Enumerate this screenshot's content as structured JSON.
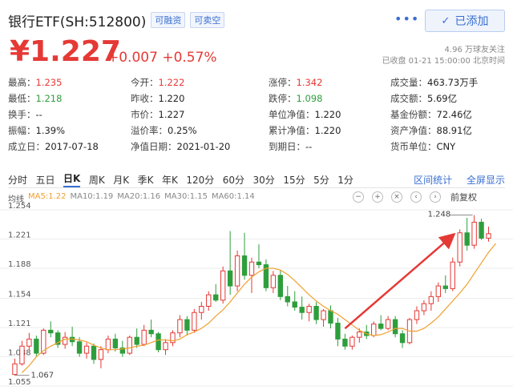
{
  "header": {
    "name": "银行ETF(SH:512800)",
    "tags": [
      "可融资",
      "可卖空"
    ],
    "more_icon": "ellipsis-icon",
    "add_button": "已添加"
  },
  "quote": {
    "price": "¥1.227",
    "change": "+0.007",
    "change_pct": "+0.57%",
    "followers": "4.96 万球友关注",
    "status_time": "已收盘 01-21 15:00:00 北京时间"
  },
  "stats": [
    [
      {
        "label": "最高：",
        "value": "1.235",
        "color": "red"
      },
      {
        "label": "今开：",
        "value": "1.222",
        "color": "red"
      },
      {
        "label": "涨停：",
        "value": "1.342",
        "color": "red"
      },
      {
        "label": "成交量：",
        "value": "463.73万手",
        "color": ""
      }
    ],
    [
      {
        "label": "最低：",
        "value": "1.218",
        "color": "green"
      },
      {
        "label": "昨收：",
        "value": "1.220",
        "color": ""
      },
      {
        "label": "跌停：",
        "value": "1.098",
        "color": "green"
      },
      {
        "label": "成交额：",
        "value": "5.69亿",
        "color": ""
      }
    ],
    [
      {
        "label": "换手：",
        "value": "--",
        "color": ""
      },
      {
        "label": "市价：",
        "value": "1.227",
        "color": ""
      },
      {
        "label": "单位净值：",
        "value": "1.220",
        "color": ""
      },
      {
        "label": "基金份额：",
        "value": "72.46亿",
        "color": ""
      }
    ],
    [
      {
        "label": "振幅：",
        "value": "1.39%",
        "color": ""
      },
      {
        "label": "溢价率：",
        "value": "0.25%",
        "color": ""
      },
      {
        "label": "累计净值：",
        "value": "1.220",
        "color": ""
      },
      {
        "label": "资产净值：",
        "value": "88.91亿",
        "color": ""
      }
    ],
    [
      {
        "label": "成立日：",
        "value": "2017-07-18",
        "color": ""
      },
      {
        "label": "净值日期：",
        "value": "2021-01-20",
        "color": ""
      },
      {
        "label": "到期日：",
        "value": "--",
        "color": ""
      },
      {
        "label": "货币单位：",
        "value": "CNY",
        "color": ""
      }
    ]
  ],
  "tabs": [
    "分时",
    "五日",
    "日K",
    "周K",
    "月K",
    "季K",
    "年K",
    "120分",
    "60分",
    "30分",
    "15分",
    "5分",
    "1分"
  ],
  "active_tab": "日K",
  "tab_links": [
    "区间统计",
    "全屏显示"
  ],
  "ma_legend": [
    {
      "label": "均线",
      "color": "#555555"
    },
    {
      "label": "MA5:1.22",
      "color": "#f0a030"
    },
    {
      "label": "MA10:1.19",
      "color": "#888888"
    },
    {
      "label": "MA20:1.16",
      "color": "#888888"
    },
    {
      "label": "MA30:1.15",
      "color": "#888888"
    },
    {
      "label": "MA60:1.14",
      "color": "#888888"
    }
  ],
  "chart_controls": {
    "icons": [
      "zoom-out-icon",
      "zoom-in-icon",
      "zoom-reset-icon",
      "scroll-left-icon",
      "scroll-right-icon"
    ],
    "adjust_label": "前复权"
  },
  "colors": {
    "up": "#e53935",
    "down": "#2e9e3d",
    "ma5": "#f0a030",
    "accent": "#3a6fd1"
  },
  "chart_data": {
    "type": "candlestick",
    "y_ticks": [
      "1.254",
      "1.221",
      "1.188",
      "1.154",
      "1.121",
      "1.088",
      "1.055"
    ],
    "ylim": [
      1.055,
      1.254
    ],
    "annotations": {
      "high": "1.248",
      "low": "1.067"
    },
    "candles": [
      {
        "o": 1.068,
        "h": 1.086,
        "l": 1.067,
        "c": 1.08
      },
      {
        "o": 1.08,
        "h": 1.106,
        "l": 1.078,
        "c": 1.1
      },
      {
        "o": 1.1,
        "h": 1.115,
        "l": 1.096,
        "c": 1.108
      },
      {
        "o": 1.108,
        "h": 1.112,
        "l": 1.088,
        "c": 1.092
      },
      {
        "o": 1.092,
        "h": 1.12,
        "l": 1.09,
        "c": 1.118
      },
      {
        "o": 1.118,
        "h": 1.128,
        "l": 1.11,
        "c": 1.115
      },
      {
        "o": 1.115,
        "h": 1.118,
        "l": 1.098,
        "c": 1.102
      },
      {
        "o": 1.102,
        "h": 1.116,
        "l": 1.097,
        "c": 1.11
      },
      {
        "o": 1.11,
        "h": 1.122,
        "l": 1.1,
        "c": 1.105
      },
      {
        "o": 1.105,
        "h": 1.11,
        "l": 1.088,
        "c": 1.092
      },
      {
        "o": 1.092,
        "h": 1.104,
        "l": 1.086,
        "c": 1.1
      },
      {
        "o": 1.1,
        "h": 1.103,
        "l": 1.08,
        "c": 1.085
      },
      {
        "o": 1.085,
        "h": 1.1,
        "l": 1.075,
        "c": 1.096
      },
      {
        "o": 1.096,
        "h": 1.112,
        "l": 1.092,
        "c": 1.108
      },
      {
        "o": 1.108,
        "h": 1.114,
        "l": 1.094,
        "c": 1.098
      },
      {
        "o": 1.098,
        "h": 1.106,
        "l": 1.088,
        "c": 1.092
      },
      {
        "o": 1.092,
        "h": 1.112,
        "l": 1.09,
        "c": 1.11
      },
      {
        "o": 1.11,
        "h": 1.12,
        "l": 1.098,
        "c": 1.102
      },
      {
        "o": 1.102,
        "h": 1.124,
        "l": 1.1,
        "c": 1.118
      },
      {
        "o": 1.118,
        "h": 1.13,
        "l": 1.11,
        "c": 1.114
      },
      {
        "o": 1.114,
        "h": 1.116,
        "l": 1.093,
        "c": 1.096
      },
      {
        "o": 1.096,
        "h": 1.108,
        "l": 1.09,
        "c": 1.104
      },
      {
        "o": 1.104,
        "h": 1.118,
        "l": 1.1,
        "c": 1.115
      },
      {
        "o": 1.115,
        "h": 1.135,
        "l": 1.11,
        "c": 1.13
      },
      {
        "o": 1.13,
        "h": 1.134,
        "l": 1.112,
        "c": 1.118
      },
      {
        "o": 1.118,
        "h": 1.142,
        "l": 1.115,
        "c": 1.138
      },
      {
        "o": 1.138,
        "h": 1.15,
        "l": 1.13,
        "c": 1.145
      },
      {
        "o": 1.145,
        "h": 1.162,
        "l": 1.14,
        "c": 1.158
      },
      {
        "o": 1.158,
        "h": 1.17,
        "l": 1.15,
        "c": 1.152
      },
      {
        "o": 1.152,
        "h": 1.19,
        "l": 1.148,
        "c": 1.185
      },
      {
        "o": 1.185,
        "h": 1.23,
        "l": 1.158,
        "c": 1.168
      },
      {
        "o": 1.168,
        "h": 1.208,
        "l": 1.162,
        "c": 1.202
      },
      {
        "o": 1.202,
        "h": 1.228,
        "l": 1.175,
        "c": 1.18
      },
      {
        "o": 1.18,
        "h": 1.2,
        "l": 1.16,
        "c": 1.195
      },
      {
        "o": 1.195,
        "h": 1.215,
        "l": 1.188,
        "c": 1.192
      },
      {
        "o": 1.192,
        "h": 1.198,
        "l": 1.162,
        "c": 1.166
      },
      {
        "o": 1.166,
        "h": 1.185,
        "l": 1.16,
        "c": 1.18
      },
      {
        "o": 1.18,
        "h": 1.186,
        "l": 1.152,
        "c": 1.156
      },
      {
        "o": 1.156,
        "h": 1.168,
        "l": 1.145,
        "c": 1.15
      },
      {
        "o": 1.15,
        "h": 1.162,
        "l": 1.14,
        "c": 1.144
      },
      {
        "o": 1.144,
        "h": 1.156,
        "l": 1.13,
        "c": 1.138
      },
      {
        "o": 1.138,
        "h": 1.148,
        "l": 1.128,
        "c": 1.145
      },
      {
        "o": 1.145,
        "h": 1.15,
        "l": 1.125,
        "c": 1.13
      },
      {
        "o": 1.13,
        "h": 1.142,
        "l": 1.122,
        "c": 1.14
      },
      {
        "o": 1.14,
        "h": 1.146,
        "l": 1.12,
        "c": 1.126
      },
      {
        "o": 1.126,
        "h": 1.132,
        "l": 1.1,
        "c": 1.108
      },
      {
        "o": 1.108,
        "h": 1.114,
        "l": 1.096,
        "c": 1.1
      },
      {
        "o": 1.1,
        "h": 1.112,
        "l": 1.096,
        "c": 1.11
      },
      {
        "o": 1.11,
        "h": 1.12,
        "l": 1.104,
        "c": 1.116
      },
      {
        "o": 1.116,
        "h": 1.124,
        "l": 1.108,
        "c": 1.112
      },
      {
        "o": 1.112,
        "h": 1.128,
        "l": 1.11,
        "c": 1.125
      },
      {
        "o": 1.125,
        "h": 1.135,
        "l": 1.118,
        "c": 1.12
      },
      {
        "o": 1.12,
        "h": 1.134,
        "l": 1.118,
        "c": 1.13
      },
      {
        "o": 1.13,
        "h": 1.134,
        "l": 1.11,
        "c": 1.114
      },
      {
        "o": 1.114,
        "h": 1.118,
        "l": 1.098,
        "c": 1.104
      },
      {
        "o": 1.104,
        "h": 1.132,
        "l": 1.102,
        "c": 1.13
      },
      {
        "o": 1.13,
        "h": 1.145,
        "l": 1.125,
        "c": 1.14
      },
      {
        "o": 1.14,
        "h": 1.152,
        "l": 1.135,
        "c": 1.148
      },
      {
        "o": 1.148,
        "h": 1.162,
        "l": 1.14,
        "c": 1.156
      },
      {
        "o": 1.156,
        "h": 1.172,
        "l": 1.15,
        "c": 1.168
      },
      {
        "o": 1.168,
        "h": 1.18,
        "l": 1.16,
        "c": 1.165
      },
      {
        "o": 1.165,
        "h": 1.2,
        "l": 1.162,
        "c": 1.195
      },
      {
        "o": 1.195,
        "h": 1.232,
        "l": 1.19,
        "c": 1.228
      },
      {
        "o": 1.228,
        "h": 1.245,
        "l": 1.208,
        "c": 1.214
      },
      {
        "o": 1.214,
        "h": 1.248,
        "l": 1.21,
        "c": 1.24
      },
      {
        "o": 1.24,
        "h": 1.244,
        "l": 1.22,
        "c": 1.222
      },
      {
        "o": 1.222,
        "h": 1.235,
        "l": 1.218,
        "c": 1.227
      }
    ],
    "ma5": [
      1.07,
      1.078,
      1.088,
      1.095,
      1.1,
      1.104,
      1.108,
      1.108,
      1.107,
      1.105,
      1.101,
      1.098,
      1.096,
      1.096,
      1.097,
      1.098,
      1.1,
      1.101,
      1.104,
      1.107,
      1.107,
      1.106,
      1.108,
      1.113,
      1.116,
      1.12,
      1.126,
      1.134,
      1.141,
      1.15,
      1.16,
      1.17,
      1.178,
      1.184,
      1.188,
      1.188,
      1.186,
      1.181,
      1.174,
      1.166,
      1.158,
      1.151,
      1.145,
      1.14,
      1.136,
      1.13,
      1.124,
      1.118,
      1.114,
      1.112,
      1.113,
      1.116,
      1.12,
      1.12,
      1.117,
      1.117,
      1.12,
      1.126,
      1.133,
      1.142,
      1.151,
      1.16,
      1.17,
      1.182,
      1.194,
      1.206,
      1.216
    ]
  }
}
